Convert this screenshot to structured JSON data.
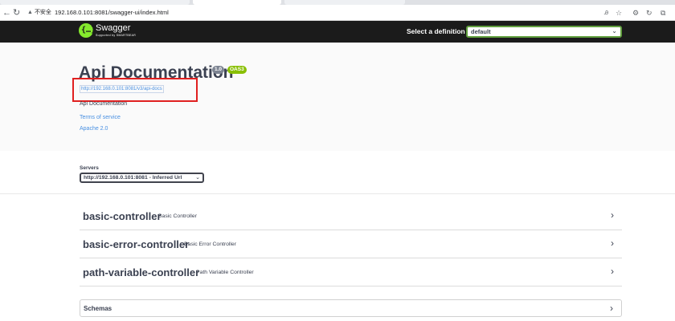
{
  "browser": {
    "security_label": "不安全",
    "url": "192.168.0.101:8081/swagger-ui/index.html",
    "icons": [
      "back-icon",
      "reload-icon",
      "warning-icon",
      "translate-icon",
      "star-icon",
      "extensions-icon",
      "sync-icon",
      "browser-menu-icon"
    ]
  },
  "topbar": {
    "brand": "Swagger",
    "brand_sub": "Supported by SMARTBEAR",
    "select_label": "Select a definition",
    "definition_value": "default",
    "logo_color": "#85ea2d",
    "background_color": "#1b1b1b"
  },
  "info": {
    "title": "Api Documentation",
    "version": "1.0",
    "oas": "OAS3",
    "docs_url": "http://192.168.0.101:8081/v3/api-docs",
    "description": "Api Documentation",
    "terms_link": "Terms of service",
    "license_link": "Apache 2.0"
  },
  "servers": {
    "label": "Servers",
    "selected": "http://192.168.0.101:8081 - Inferred Url"
  },
  "tags": [
    {
      "name": "basic-controller",
      "description": "Basic Controller"
    },
    {
      "name": "basic-error-controller",
      "description": "Basic Error Controller"
    },
    {
      "name": "path-variable-controller",
      "description": "Path Variable Controller"
    }
  ],
  "schemas": {
    "label": "Schemas"
  },
  "colors": {
    "link": "#4990e2",
    "version_badge": "#7d8492",
    "oas_badge": "#89bf04",
    "highlight": "#e02020",
    "text": "#3b4151"
  }
}
